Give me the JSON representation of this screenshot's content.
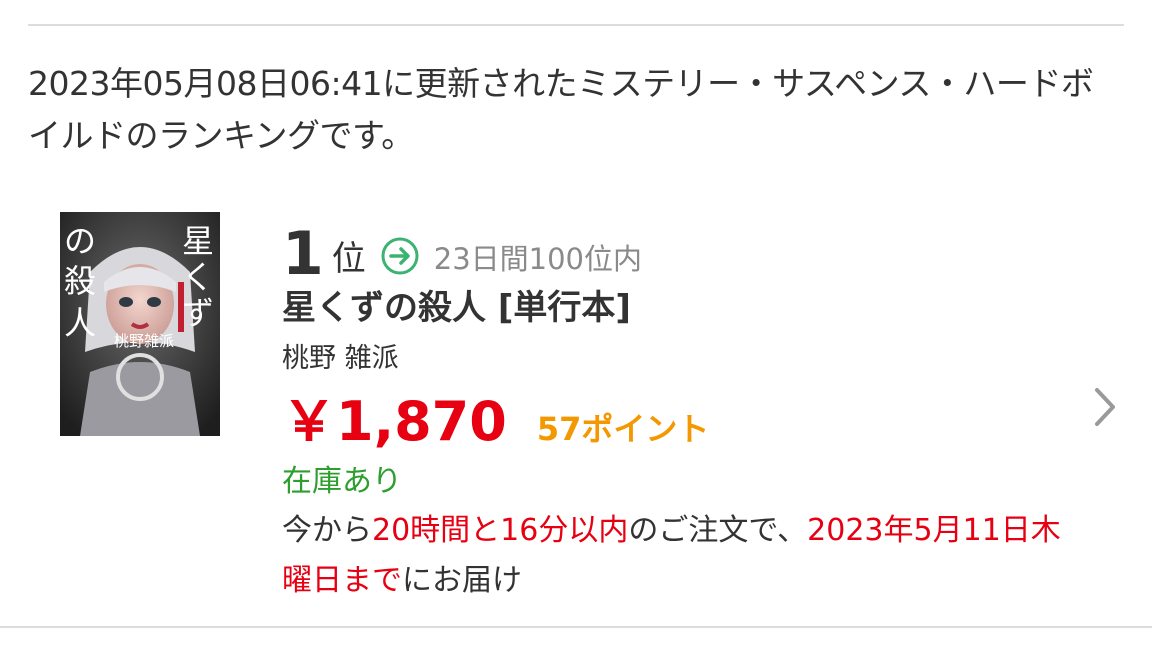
{
  "intro_text": "2023年05月08日06:41に更新されたミステリー・サスペンス・ハードボイルドのランキングです。",
  "item": {
    "cover": {
      "title_text": "星くずの殺人",
      "author_text": "桃野雑派"
    },
    "rank_number": "1",
    "rank_suffix": "位",
    "rank_trend_icon": "right-arrow-circle-icon",
    "rank_note": "23日間100位内",
    "title": "星くずの殺人 [単行本]",
    "author": "桃野 雑派",
    "price": "￥1,870",
    "points": "57ポイント",
    "stock": "在庫あり",
    "delivery": {
      "prefix": "今から",
      "time_left": "20時間と16分以内",
      "middle": "のご注文で、",
      "date": "2023年5月11日木曜日まで",
      "suffix": "にお届け"
    }
  },
  "colors": {
    "price": "#e60012",
    "points": "#f39800",
    "stock": "#2e9e2e",
    "rank_arrow": "#3cb371",
    "muted": "#8a8a8a"
  }
}
